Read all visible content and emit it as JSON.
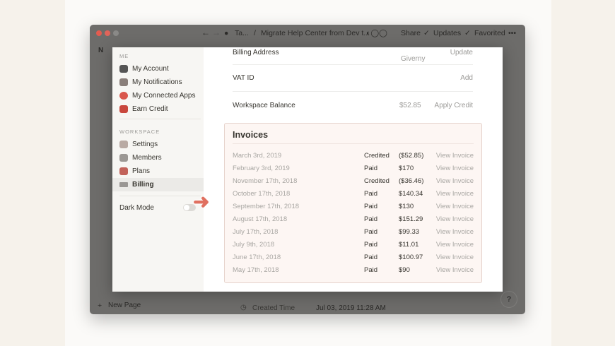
{
  "titlebar": {
    "breadcrumb_parent": "Ta...",
    "breadcrumb_sep": "/",
    "breadcrumb_page": "Migrate Help Center from Dev t...",
    "share": "Share",
    "updates": "Updates",
    "favorited": "Favorited",
    "more": "•••"
  },
  "background": {
    "bottom_prop_label": "Created Time",
    "bottom_prop_value": "Jul 03, 2019 11:28 AM",
    "new_page": "New Page",
    "help": "?"
  },
  "settings_sidebar": {
    "me_header": "ME",
    "me_items": [
      {
        "label": "My Account",
        "icon": "avatar-icon"
      },
      {
        "label": "My Notifications",
        "icon": "mailbox-icon"
      },
      {
        "label": "My Connected Apps",
        "icon": "balloon-icon"
      },
      {
        "label": "Earn Credit",
        "icon": "gift-icon"
      }
    ],
    "workspace_header": "WORKSPACE",
    "workspace_items": [
      {
        "label": "Settings",
        "icon": "building-icon"
      },
      {
        "label": "Members",
        "icon": "people-icon"
      },
      {
        "label": "Plans",
        "icon": "rocket-icon"
      },
      {
        "label": "Billing",
        "icon": "card-icon",
        "active": true
      }
    ],
    "dark_mode_label": "Dark Mode",
    "dark_mode_on": false
  },
  "billing": {
    "billing_address_label": "Billing Address",
    "billing_address_value": "Giverny",
    "billing_address_action": "Update",
    "vat_label": "VAT ID",
    "vat_action": "Add",
    "balance_label": "Workspace Balance",
    "balance_value": "$52.85",
    "balance_action": "Apply Credit",
    "invoices_title": "Invoices",
    "invoices": [
      {
        "date": "March 3rd, 2019",
        "status": "Credited",
        "amount": "($52.85)",
        "action": "View Invoice"
      },
      {
        "date": "February 3rd, 2019",
        "status": "Paid",
        "amount": "$170",
        "action": "View Invoice"
      },
      {
        "date": "November 17th, 2018",
        "status": "Credited",
        "amount": "($36.46)",
        "action": "View Invoice"
      },
      {
        "date": "October 17th, 2018",
        "status": "Paid",
        "amount": "$140.34",
        "action": "View Invoice"
      },
      {
        "date": "September 17th, 2018",
        "status": "Paid",
        "amount": "$130",
        "action": "View Invoice"
      },
      {
        "date": "August 17th, 2018",
        "status": "Paid",
        "amount": "$151.29",
        "action": "View Invoice"
      },
      {
        "date": "July 17th, 2018",
        "status": "Paid",
        "amount": "$99.33",
        "action": "View Invoice"
      },
      {
        "date": "July 9th, 2018",
        "status": "Paid",
        "amount": "$11.01",
        "action": "View Invoice"
      },
      {
        "date": "June 17th, 2018",
        "status": "Paid",
        "amount": "$100.97",
        "action": "View Invoice"
      },
      {
        "date": "May 17th, 2018",
        "status": "Paid",
        "amount": "$90",
        "action": "View Invoice"
      }
    ]
  },
  "colors": {
    "accent_arrow": "#e07060",
    "invoice_bg": "#fdf6f3",
    "invoice_border": "#e6d3cc"
  }
}
